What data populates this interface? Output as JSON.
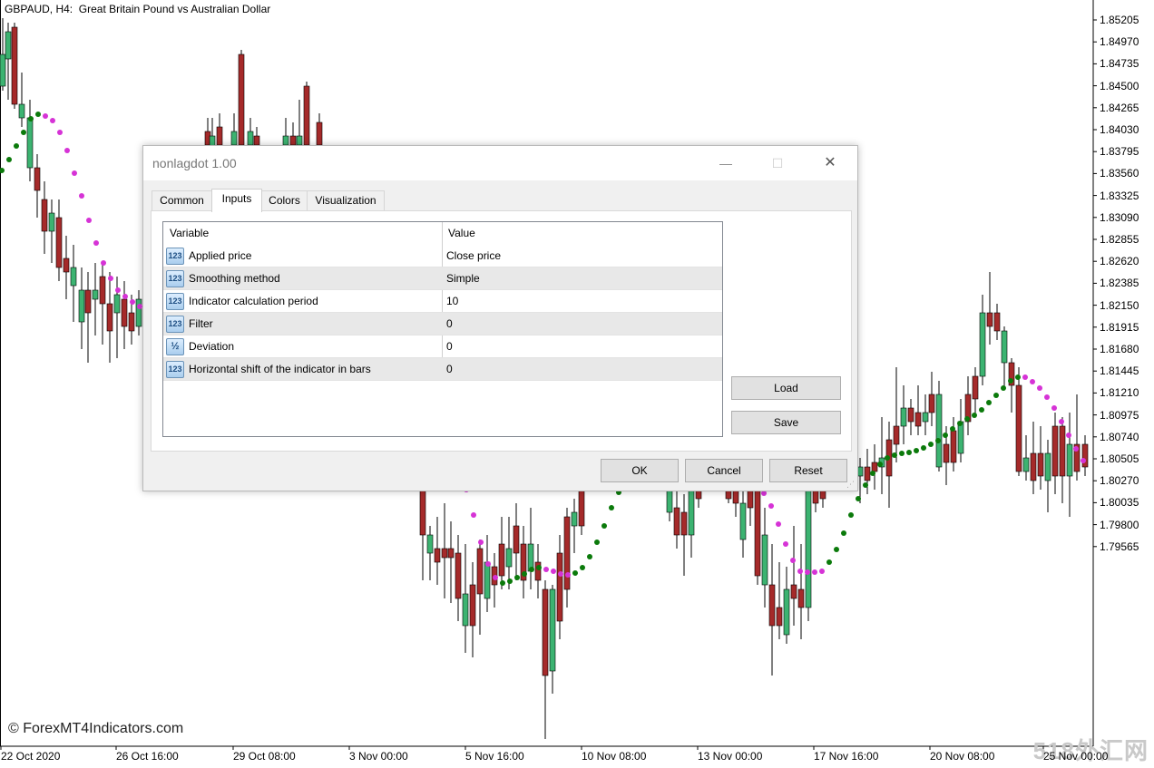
{
  "chart": {
    "title": "GBPAUD, H4:  Great Britain Pound vs Australian Dollar",
    "watermark": "© ForexMT4Indicators.com",
    "corner_brand": "518外汇网",
    "price_labels": [
      "1.85205",
      "1.84970",
      "1.84735",
      "1.84500",
      "1.84265",
      "1.84030",
      "1.83795",
      "1.83560",
      "1.83325",
      "1.83090",
      "1.82855",
      "1.82620",
      "1.82385",
      "1.82150",
      "1.81915",
      "1.81680",
      "1.81445",
      "1.81210",
      "1.80975",
      "1.80740",
      "1.80505",
      "1.80270",
      "1.80035",
      "1.79800",
      "1.79565"
    ],
    "time_labels": [
      "22 Oct 2020",
      "26 Oct 16:00",
      "29 Oct 08:00",
      "3 Nov 00:00",
      "5 Nov 16:00",
      "10 Nov 08:00",
      "13 Nov 00:00",
      "17 Nov 16:00",
      "20 Nov 08:00",
      "25 Nov 00:00"
    ],
    "colors": {
      "bull": "#3cb371",
      "bear": "#a52a2a",
      "wick": "#000000",
      "dot_up": "#0b7a0b",
      "dot_down": "#d633d6",
      "axis": "#000000"
    }
  },
  "dialog": {
    "title": "nonlagdot 1.00",
    "window_buttons": {
      "minimize": "—",
      "maximize": "☐",
      "close": "✕"
    },
    "tabs": [
      "Common",
      "Inputs",
      "Colors",
      "Visualization"
    ],
    "active_tab": "Inputs",
    "grid": {
      "headers": {
        "variable": "Variable",
        "value": "Value"
      },
      "rows": [
        {
          "icon": "123",
          "variable": "Applied price",
          "value": "Close price"
        },
        {
          "icon": "123",
          "variable": "Smoothing method",
          "value": "Simple"
        },
        {
          "icon": "123",
          "variable": "Indicator calculation period",
          "value": "10"
        },
        {
          "icon": "123",
          "variable": "Filter",
          "value": "0"
        },
        {
          "icon": "½",
          "variable": "Deviation",
          "value": "0"
        },
        {
          "icon": "123",
          "variable": "Horizontal shift of the indicator in bars",
          "value": "0"
        }
      ]
    },
    "buttons": {
      "load": "Load",
      "save": "Save",
      "ok": "OK",
      "cancel": "Cancel",
      "reset": "Reset"
    }
  }
}
